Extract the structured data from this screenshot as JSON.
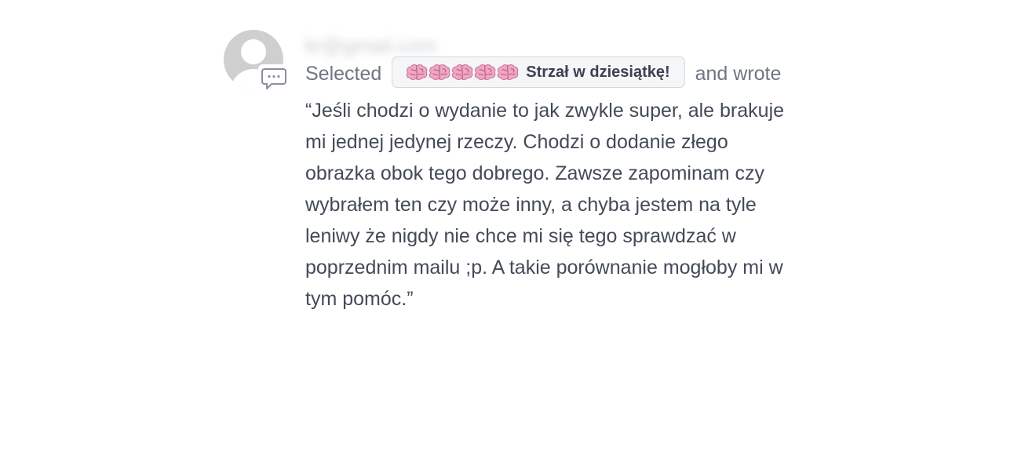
{
  "user": {
    "email": "kr@gmail.com"
  },
  "action": {
    "selected_label": "Selected",
    "after_label": "and wrote"
  },
  "rating": {
    "icon": "brain-icon",
    "count": 5,
    "label": "Strzał w dziesiątkę!"
  },
  "comment": {
    "text": "“Jeśli chodzi o wydanie to jak zwykle super, ale brakuje mi jednej jedynej rzeczy. Chodzi o dodanie złego obrazka obok tego dobrego. Zawsze zapominam czy wybrałem ten czy może inny, a chyba jestem na tyle leniwy że nigdy nie chce mi się tego sprawdzać w poprzednim mailu ;p. A takie porównanie mogłoby mi w tym pomóc.”"
  },
  "colors": {
    "pill_background": "#f5f6f8",
    "pill_border": "#d5d8de",
    "brain_pink": "#f0a7c2",
    "avatar_gray": "#cfcfcf"
  }
}
